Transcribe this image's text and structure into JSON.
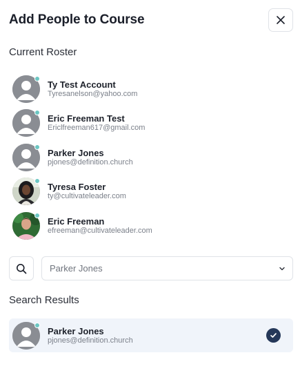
{
  "modal": {
    "title": "Add People to Course"
  },
  "roster": {
    "title": "Current Roster",
    "people": [
      {
        "name": "Ty Test Account",
        "email": "Tyresanelson@yahoo.com",
        "avatar": "placeholder"
      },
      {
        "name": "Eric Freeman Test",
        "email": "Ericlfreeman617@gmail.com",
        "avatar": "placeholder"
      },
      {
        "name": "Parker Jones",
        "email": "pjones@definition.church",
        "avatar": "placeholder"
      },
      {
        "name": "Tyresa Foster",
        "email": "ty@cultivateleader.com",
        "avatar": "photo-woman"
      },
      {
        "name": "Eric Freeman",
        "email": "efreeman@cultivateleader.com",
        "avatar": "photo-man"
      }
    ]
  },
  "search": {
    "value": "Parker Jones"
  },
  "results": {
    "title": "Search Results",
    "items": [
      {
        "name": "Parker Jones",
        "email": "pjones@definition.church",
        "selected": true
      }
    ]
  },
  "colors": {
    "online": "#6cc6c2",
    "selected_row_bg": "#f0f4fa",
    "check_bg": "#253859"
  },
  "icons": {
    "close": "close-icon",
    "search": "search-icon",
    "chevron": "chevron-down-icon",
    "check": "check-icon",
    "online": "online-status-dot"
  }
}
